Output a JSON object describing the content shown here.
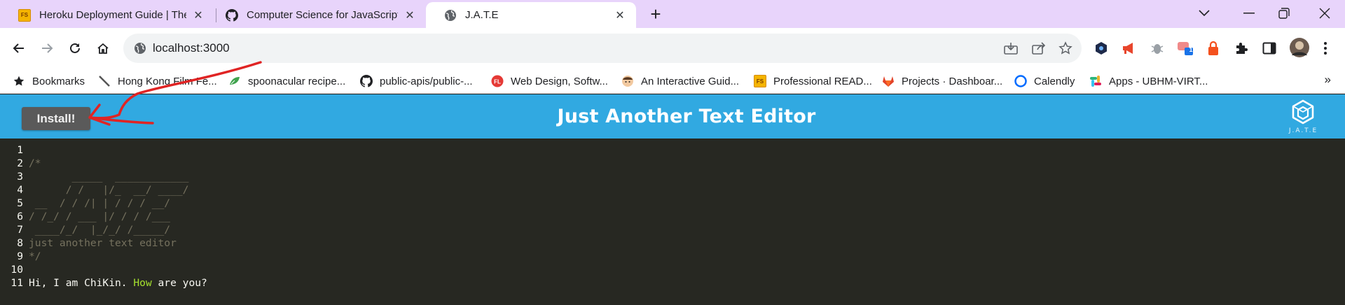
{
  "browser": {
    "tabs": [
      {
        "title": "Heroku Deployment Guide | The",
        "icon": "fs-badge",
        "active": false
      },
      {
        "title": "Computer Science for JavaScript",
        "icon": "github-icon",
        "active": false
      },
      {
        "title": "J.A.T.E",
        "icon": "globe-icon",
        "active": true
      }
    ],
    "fs_badge_text": "FS",
    "url": "localhost:3000",
    "bookmarks": [
      {
        "label": "Bookmarks",
        "icon": "star-icon"
      },
      {
        "label": "Hong Kong Film Fe...",
        "icon": "pen-icon"
      },
      {
        "label": "spoonacular recipe...",
        "icon": "leaf-icon"
      },
      {
        "label": "public-apis/public-...",
        "icon": "github-icon"
      },
      {
        "label": "Web Design, Softw...",
        "icon": "fl-icon"
      },
      {
        "label": "An Interactive Guid...",
        "icon": "avatar-icon"
      },
      {
        "label": "Professional READ...",
        "icon": "fs-badge"
      },
      {
        "label": "Projects · Dashboar...",
        "icon": "gitlab-icon"
      },
      {
        "label": "Calendly",
        "icon": "calendly-icon"
      },
      {
        "label": "Apps - UBHM-VIRT...",
        "icon": "slack-icon"
      }
    ],
    "more_bookmarks": "»",
    "extension_badge": "1"
  },
  "app": {
    "install_label": "Install!",
    "title": "Just Another Text Editor",
    "logo_text": "J.A.T.E"
  },
  "editor": {
    "lines": [
      {
        "n": "1",
        "text": "",
        "type": "plain"
      },
      {
        "n": "2",
        "text": "/*",
        "type": "comment"
      },
      {
        "n": "3",
        "text": "       _____  ____________",
        "type": "comment"
      },
      {
        "n": "4",
        "text": "      / /   |/_  __/ ____/",
        "type": "comment"
      },
      {
        "n": "5",
        "text": " __  / / /| | / / / __/",
        "type": "comment"
      },
      {
        "n": "6",
        "text": "/ /_/ / ___ |/ / / /___",
        "type": "comment"
      },
      {
        "n": "7",
        "text": " ____/_/  |_/_/ /_____/",
        "type": "comment"
      },
      {
        "n": "8",
        "text": "just another text editor",
        "type": "comment"
      },
      {
        "n": "9",
        "text": "*/",
        "type": "comment"
      },
      {
        "n": "10",
        "text": "",
        "type": "plain"
      },
      {
        "n": "11",
        "text": "Hi, I am ChiKin. How are you?",
        "type": "mixed",
        "before": "Hi, I am ChiKin. ",
        "keyword": "How",
        "after": " are you?"
      }
    ]
  },
  "colors": {
    "tabstrip": "#e8d4fb",
    "app_header": "#31a9e1",
    "editor_bg": "#272822",
    "comment": "#75715e",
    "keyword": "#a6e22e",
    "annotation": "#e02424"
  }
}
